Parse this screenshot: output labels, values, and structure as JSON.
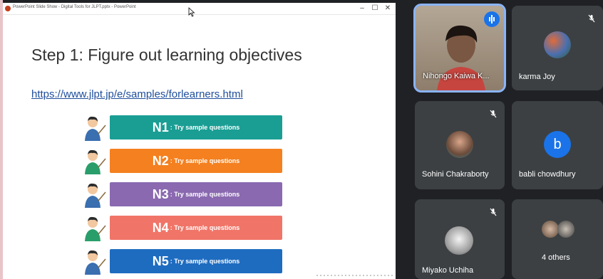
{
  "ppt": {
    "window_title": "PowerPoint Slide Show - Digital Tools for JLPT.pptx - PowerPoint",
    "minimize": "–",
    "maximize": "☐",
    "close": "✕"
  },
  "slide": {
    "title": "Step 1: Figure out learning objectives",
    "link": "https://www.jlpt.jp/e/samples/forlearners.html",
    "levels": [
      {
        "code": "N1",
        "text": ": Try sample questions",
        "color": "#1a9e94"
      },
      {
        "code": "N2",
        "text": ": Try sample questions",
        "color": "#f4801f"
      },
      {
        "code": "N3",
        "text": ": Try sample questions",
        "color": "#8a69b0"
      },
      {
        "code": "N4",
        "text": ": Try sample questions",
        "color": "#f07568"
      },
      {
        "code": "N5",
        "text": ": Try sample questions",
        "color": "#1e6cc0"
      }
    ]
  },
  "meet": {
    "participants": [
      {
        "name": "Nihongo Kaiwa K...",
        "state": "speaking"
      },
      {
        "name": "karma Joy",
        "state": "muted"
      },
      {
        "name": "Sohini Chakraborty",
        "state": "muted"
      },
      {
        "name": "babli chowdhury",
        "avatar_letter": "b"
      },
      {
        "name": "Miyako Uchiha",
        "state": "muted"
      },
      {
        "name": "4 others"
      }
    ]
  }
}
